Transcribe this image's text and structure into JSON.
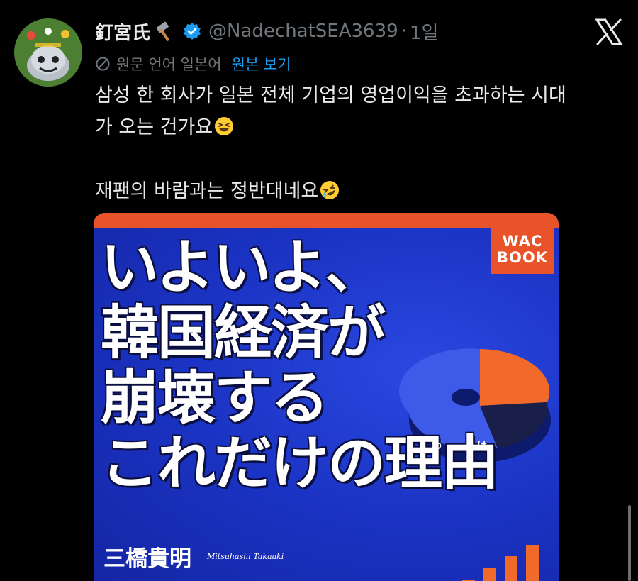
{
  "tweet": {
    "display_name": "釘宮氏",
    "handle": "@NadechatSEA3639",
    "separator": "·",
    "time": "1일",
    "translated_from": "원문 언어 일본어",
    "show_original": "원본 보기",
    "text_line1": "삼성 한 회사가 일본 전체 기업의 영업이익을 초과하는 시대",
    "text_line2": "가 오는 건가요",
    "text_line3": "재팬의 바람과는 정반대네요"
  },
  "book": {
    "publisher_line1": "WAC",
    "publisher_line2": "BOOK",
    "title_line1": "いよいよ、",
    "title_line2": "韓国経済が",
    "title_line3": "崩壊する",
    "title_line4": "これだけの理由",
    "ruby1": "わ",
    "ruby2": "け",
    "author": "三橋貴明",
    "author_roman": "Mitsuhashi Takaaki"
  },
  "icons": {
    "avatar": "avatar-icon",
    "hammer": "hammer-emoji-icon",
    "verified": "verified-badge-icon",
    "x_logo": "x-logo-icon",
    "translate": "translate-icon",
    "emoji1": "laughing-emoji-icon",
    "emoji2": "rolling-laughing-emoji-icon"
  },
  "colors": {
    "background": "#000000",
    "text": "#e7e9ea",
    "muted": "#71767b",
    "link": "#1d9bf0",
    "cover_blue": "#1b33c4",
    "cover_orange": "#e8532a"
  }
}
